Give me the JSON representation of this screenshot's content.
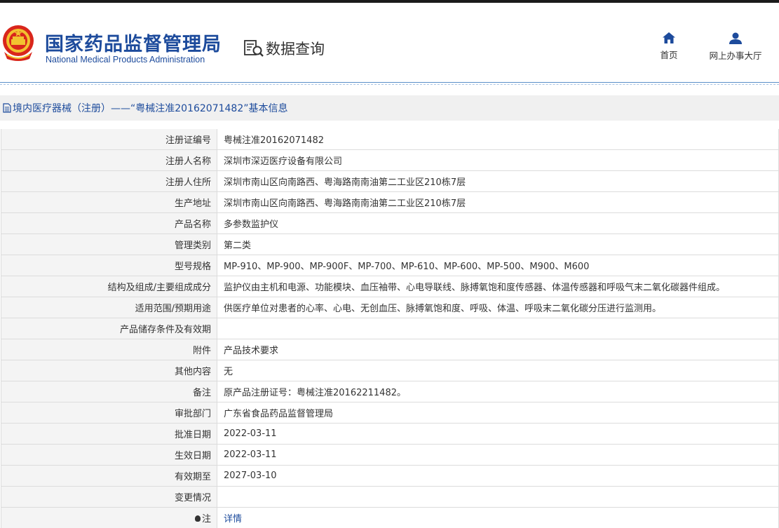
{
  "header": {
    "org_name_cn": "国家药品监督管理局",
    "org_name_en": "National Medical Products Administration",
    "query_label": "数据查询",
    "nav": [
      {
        "label": "首页",
        "icon": "home-icon"
      },
      {
        "label": "网上办事大厅",
        "icon": "user-icon"
      }
    ]
  },
  "colors": {
    "brand": "#1d4b9c",
    "title_bar_bg": "#f0f0f0",
    "label_bg": "#f4f4f4",
    "border": "#dcdcdc"
  },
  "title": "境内医疗器械（注册）——“粤械注准20162071482”基本信息",
  "rows": [
    {
      "label": "注册证编号",
      "value": "粤械注准20162071482"
    },
    {
      "label": "注册人名称",
      "value": "深圳市深迈医疗设备有限公司"
    },
    {
      "label": "注册人住所",
      "value": "深圳市南山区向南路西、粤海路南南油第二工业区210栋7层"
    },
    {
      "label": "生产地址",
      "value": "深圳市南山区向南路西、粤海路南南油第二工业区210栋7层"
    },
    {
      "label": "产品名称",
      "value": "多参数监护仪"
    },
    {
      "label": "管理类别",
      "value": "第二类"
    },
    {
      "label": "型号规格",
      "value": "MP-910、MP-900、MP-900F、MP-700、MP-610、MP-600、MP-500、M900、M600"
    },
    {
      "label": "结构及组成/主要组成成分",
      "value": "监护仪由主机和电源、功能模块、血压袖带、心电导联线、脉搏氧饱和度传感器、体温传感器和呼吸气末二氧化碳器件组成。"
    },
    {
      "label": "适用范围/预期用途",
      "value": "供医疗单位对患者的心率、心电、无创血压、脉搏氧饱和度、呼吸、体温、呼吸末二氧化碳分压进行监测用。"
    },
    {
      "label": "产品储存条件及有效期",
      "value": ""
    },
    {
      "label": "附件",
      "value": "产品技术要求"
    },
    {
      "label": "其他内容",
      "value": "无"
    },
    {
      "label": "备注",
      "value": "原产品注册证号：粤械注准20162211482。"
    },
    {
      "label": "审批部门",
      "value": "广东省食品药品监督管理局"
    },
    {
      "label": "批准日期",
      "value": "2022-03-11"
    },
    {
      "label": "生效日期",
      "value": "2022-03-11"
    },
    {
      "label": "有效期至",
      "value": "2027-03-10"
    },
    {
      "label": "变更情况",
      "value": ""
    }
  ],
  "note_row": {
    "label": "注",
    "icon": "bulb-icon",
    "link": "详情"
  }
}
